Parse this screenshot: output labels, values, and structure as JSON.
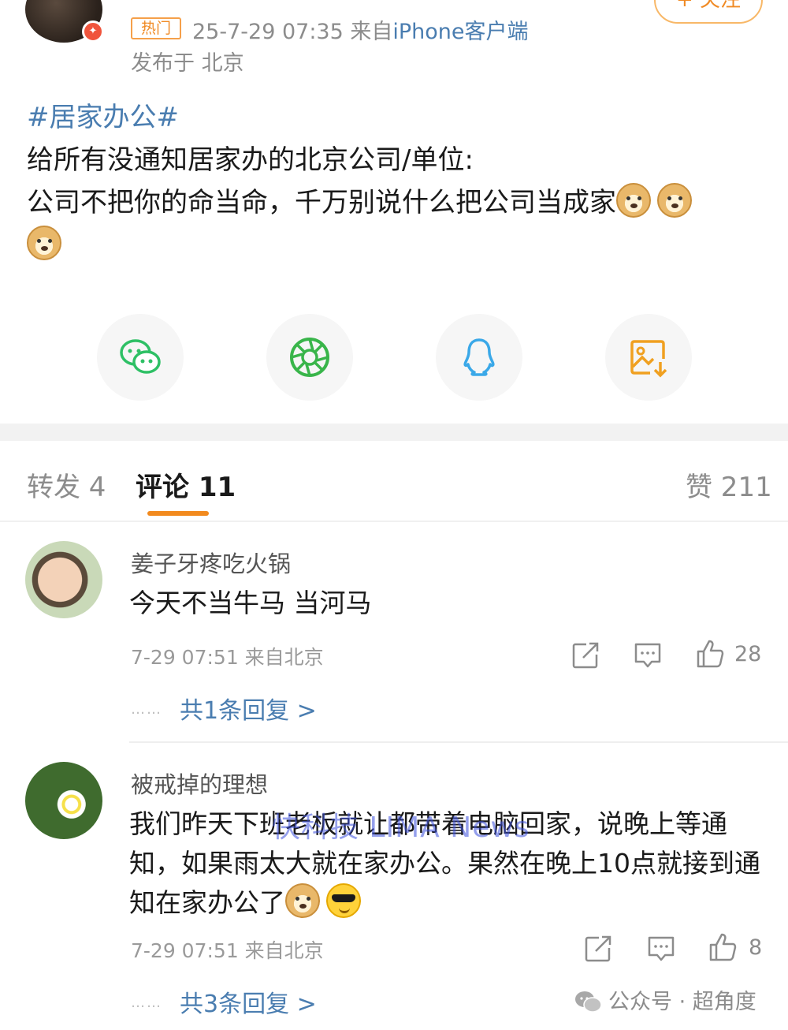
{
  "post": {
    "hot_badge": "热门",
    "meta": "25-7-29 07:35  来自",
    "client": "iPhone客户端",
    "location": "发布于 北京",
    "follow_label": "+ 关注",
    "hashtag": "#居家办公#",
    "line1": "给所有没通知居家办的北京公司/单位:",
    "line2": "公司不把你的命当命，千万别说什么把公司当成家"
  },
  "share": {
    "icons": [
      "wechat-icon",
      "moments-icon",
      "qq-icon",
      "save-image-icon"
    ],
    "colors": {
      "wechat": "#2ec065",
      "moments": "#39b54a",
      "qq": "#3aa8e8",
      "save": "#f0a020"
    }
  },
  "tabs": {
    "repost": "转发 4",
    "comments": "评论 11",
    "likes": "赞 211"
  },
  "comments": [
    {
      "name": "姜子牙疼吃火锅",
      "text": "今天不当牛马 当河马",
      "time": "7-29 07:51 来自北京",
      "likes": "28",
      "replies": "共1条回复 >"
    },
    {
      "name": "被戒掉的理想",
      "text": "我们昨天下班老板就让都带着电脑回家，说晚上等通知，如果雨太大就在家办公。果然在晚上10点就接到通知在家办公了",
      "time": "7-29 07:51 来自北京",
      "likes": "8",
      "replies": "共3条回复 >"
    }
  ],
  "watermark": "快科技 LIMA News",
  "account_mark": "公众号 · 超角度",
  "colors": {
    "accent": "#f28a1e",
    "link": "#4a7db0"
  }
}
